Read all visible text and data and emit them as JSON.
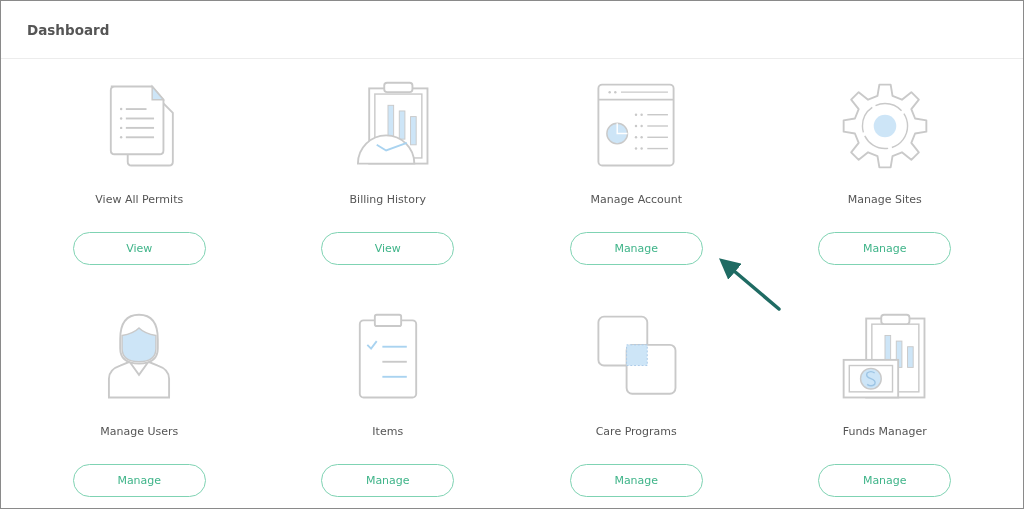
{
  "header": {
    "title": "Dashboard"
  },
  "tiles": [
    {
      "label": "View All Permits",
      "button": "View"
    },
    {
      "label": "Billing History",
      "button": "View"
    },
    {
      "label": "Manage Account",
      "button": "Manage"
    },
    {
      "label": "Manage Sites",
      "button": "Manage"
    },
    {
      "label": "Manage Users",
      "button": "Manage"
    },
    {
      "label": "Items",
      "button": "Manage"
    },
    {
      "label": "Care Programs",
      "button": "Manage"
    },
    {
      "label": "Funds Manager",
      "button": "Manage"
    }
  ]
}
